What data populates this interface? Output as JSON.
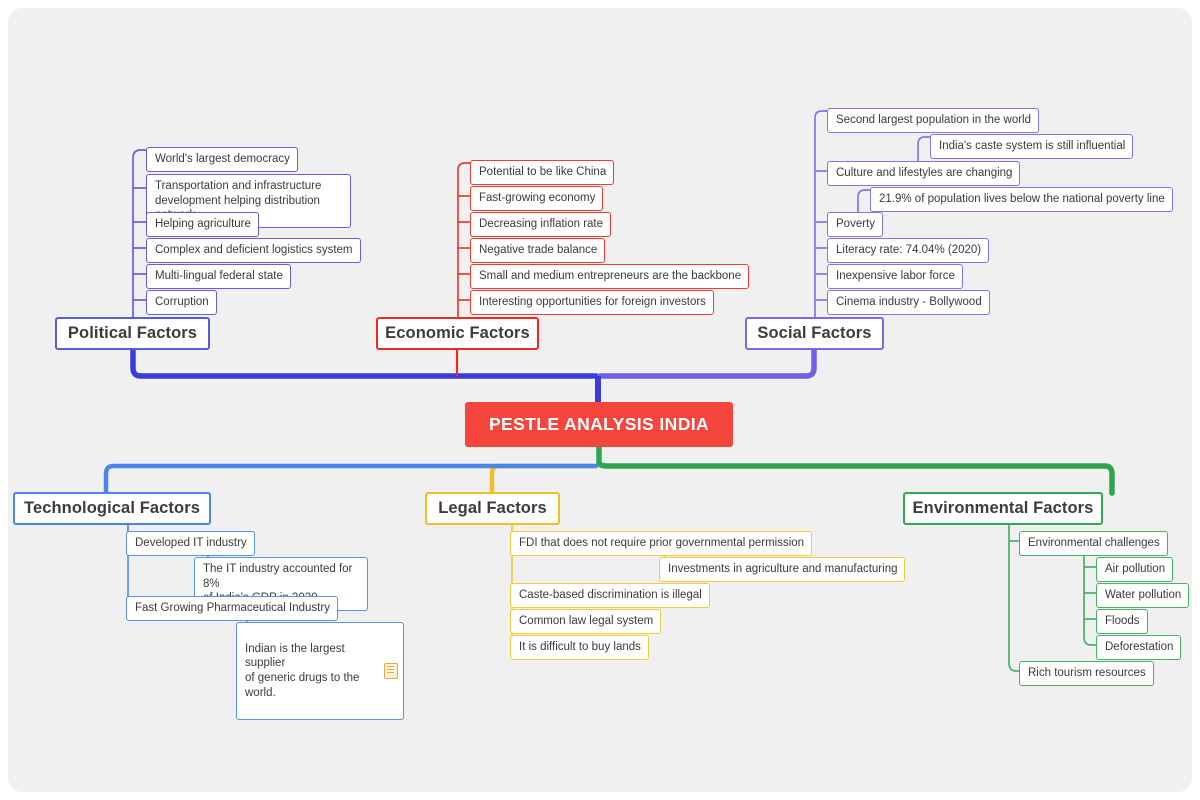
{
  "diagram": {
    "type": "mindmap",
    "center": {
      "label": "PESTLE ANALYSIS INDIA",
      "fill": "#f4463c",
      "text_color": "#ffffff"
    },
    "colors": {
      "political": "#5b5be0",
      "economic": "#ef2a21",
      "social": "#7a6ae6",
      "technological": "#4a86e8",
      "legal": "#f2bf28",
      "environmental": "#34a853",
      "canvas_background": "#f0f0f0",
      "node_fill": "#ffffff",
      "node_text": "#3a3a3a"
    },
    "branches": {
      "political": {
        "title": "Political Factors",
        "children": [
          {
            "label": "World's largest democracy"
          },
          {
            "label": "Transportation and infrastructure\ndevelopment helping distribution network"
          },
          {
            "label": "Helping agriculture"
          },
          {
            "label": "Complex and deficient logistics system"
          },
          {
            "label": "Multi-lingual federal state"
          },
          {
            "label": "Corruption"
          }
        ]
      },
      "economic": {
        "title": "Economic Factors",
        "children": [
          {
            "label": "Potential to be like China"
          },
          {
            "label": "Fast-growing economy"
          },
          {
            "label": "Decreasing inflation rate"
          },
          {
            "label": "Negative trade balance"
          },
          {
            "label": "Small and medium entrepreneurs are the backbone"
          },
          {
            "label": "Interesting opportunities for foreign investors"
          }
        ]
      },
      "social": {
        "title": "Social Factors",
        "children": [
          {
            "label": "Second largest population in the world"
          },
          {
            "label": "Culture and lifestyles are changing",
            "sub": [
              {
                "label": "India's caste system is still influential"
              }
            ]
          },
          {
            "label": "Poverty",
            "sub": [
              {
                "label": "21.9% of population lives below the national poverty line"
              }
            ]
          },
          {
            "label": "Literacy rate: 74.04% (2020)"
          },
          {
            "label": "Inexpensive labor force"
          },
          {
            "label": "Cinema industry - Bollywood"
          }
        ]
      },
      "technological": {
        "title": "Technological Factors",
        "children": [
          {
            "label": "Developed IT industry",
            "sub": [
              {
                "label": "The IT industry accounted for 8%\nof India's GDP in 2020."
              }
            ]
          },
          {
            "label": "Fast Growing Pharmaceutical Industry",
            "sub": [
              {
                "label": "Indian is the largest supplier\nof generic drugs to the world.",
                "icon": "note-icon"
              }
            ]
          }
        ]
      },
      "legal": {
        "title": "Legal Factors",
        "children": [
          {
            "label": "FDI that does not require prior governmental permission",
            "sub": [
              {
                "label": "Investments in agriculture and manufacturing"
              }
            ]
          },
          {
            "label": "Caste-based discrimination is illegal"
          },
          {
            "label": "Common law legal system"
          },
          {
            "label": "It is difficult to buy lands"
          }
        ]
      },
      "environmental": {
        "title": "Environmental Factors",
        "children": [
          {
            "label": "Environmental challenges",
            "sub": [
              {
                "label": "Air pollution"
              },
              {
                "label": "Water pollution"
              },
              {
                "label": "Floods"
              },
              {
                "label": "Deforestation"
              }
            ]
          },
          {
            "label": "Rich tourism resources"
          }
        ]
      }
    }
  }
}
